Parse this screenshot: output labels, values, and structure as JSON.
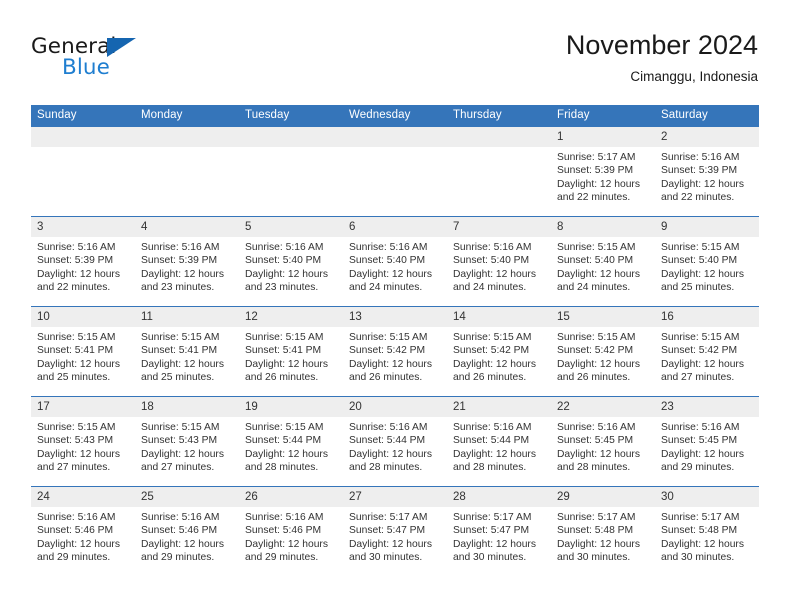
{
  "brand": {
    "word1": "General",
    "word2": "Blue",
    "logo_icon": "triangle-logo-icon",
    "accent_color": "#1f7ed0"
  },
  "header": {
    "title": "November 2024",
    "location": "Cimanggu, Indonesia"
  },
  "theme": {
    "header_bg": "#3575ba",
    "daynum_bg": "#eeeeee",
    "text": "#333333"
  },
  "calendar": {
    "weekday_headers": [
      "Sunday",
      "Monday",
      "Tuesday",
      "Wednesday",
      "Thursday",
      "Friday",
      "Saturday"
    ],
    "weeks": [
      [
        {
          "day": "",
          "empty": true
        },
        {
          "day": "",
          "empty": true
        },
        {
          "day": "",
          "empty": true
        },
        {
          "day": "",
          "empty": true
        },
        {
          "day": "",
          "empty": true
        },
        {
          "day": "1",
          "sunrise": "Sunrise: 5:17 AM",
          "sunset": "Sunset: 5:39 PM",
          "daylight1": "Daylight: 12 hours",
          "daylight2": "and 22 minutes."
        },
        {
          "day": "2",
          "sunrise": "Sunrise: 5:16 AM",
          "sunset": "Sunset: 5:39 PM",
          "daylight1": "Daylight: 12 hours",
          "daylight2": "and 22 minutes."
        }
      ],
      [
        {
          "day": "3",
          "sunrise": "Sunrise: 5:16 AM",
          "sunset": "Sunset: 5:39 PM",
          "daylight1": "Daylight: 12 hours",
          "daylight2": "and 22 minutes."
        },
        {
          "day": "4",
          "sunrise": "Sunrise: 5:16 AM",
          "sunset": "Sunset: 5:39 PM",
          "daylight1": "Daylight: 12 hours",
          "daylight2": "and 23 minutes."
        },
        {
          "day": "5",
          "sunrise": "Sunrise: 5:16 AM",
          "sunset": "Sunset: 5:40 PM",
          "daylight1": "Daylight: 12 hours",
          "daylight2": "and 23 minutes."
        },
        {
          "day": "6",
          "sunrise": "Sunrise: 5:16 AM",
          "sunset": "Sunset: 5:40 PM",
          "daylight1": "Daylight: 12 hours",
          "daylight2": "and 24 minutes."
        },
        {
          "day": "7",
          "sunrise": "Sunrise: 5:16 AM",
          "sunset": "Sunset: 5:40 PM",
          "daylight1": "Daylight: 12 hours",
          "daylight2": "and 24 minutes."
        },
        {
          "day": "8",
          "sunrise": "Sunrise: 5:15 AM",
          "sunset": "Sunset: 5:40 PM",
          "daylight1": "Daylight: 12 hours",
          "daylight2": "and 24 minutes."
        },
        {
          "day": "9",
          "sunrise": "Sunrise: 5:15 AM",
          "sunset": "Sunset: 5:40 PM",
          "daylight1": "Daylight: 12 hours",
          "daylight2": "and 25 minutes."
        }
      ],
      [
        {
          "day": "10",
          "sunrise": "Sunrise: 5:15 AM",
          "sunset": "Sunset: 5:41 PM",
          "daylight1": "Daylight: 12 hours",
          "daylight2": "and 25 minutes."
        },
        {
          "day": "11",
          "sunrise": "Sunrise: 5:15 AM",
          "sunset": "Sunset: 5:41 PM",
          "daylight1": "Daylight: 12 hours",
          "daylight2": "and 25 minutes."
        },
        {
          "day": "12",
          "sunrise": "Sunrise: 5:15 AM",
          "sunset": "Sunset: 5:41 PM",
          "daylight1": "Daylight: 12 hours",
          "daylight2": "and 26 minutes."
        },
        {
          "day": "13",
          "sunrise": "Sunrise: 5:15 AM",
          "sunset": "Sunset: 5:42 PM",
          "daylight1": "Daylight: 12 hours",
          "daylight2": "and 26 minutes."
        },
        {
          "day": "14",
          "sunrise": "Sunrise: 5:15 AM",
          "sunset": "Sunset: 5:42 PM",
          "daylight1": "Daylight: 12 hours",
          "daylight2": "and 26 minutes."
        },
        {
          "day": "15",
          "sunrise": "Sunrise: 5:15 AM",
          "sunset": "Sunset: 5:42 PM",
          "daylight1": "Daylight: 12 hours",
          "daylight2": "and 26 minutes."
        },
        {
          "day": "16",
          "sunrise": "Sunrise: 5:15 AM",
          "sunset": "Sunset: 5:42 PM",
          "daylight1": "Daylight: 12 hours",
          "daylight2": "and 27 minutes."
        }
      ],
      [
        {
          "day": "17",
          "sunrise": "Sunrise: 5:15 AM",
          "sunset": "Sunset: 5:43 PM",
          "daylight1": "Daylight: 12 hours",
          "daylight2": "and 27 minutes."
        },
        {
          "day": "18",
          "sunrise": "Sunrise: 5:15 AM",
          "sunset": "Sunset: 5:43 PM",
          "daylight1": "Daylight: 12 hours",
          "daylight2": "and 27 minutes."
        },
        {
          "day": "19",
          "sunrise": "Sunrise: 5:15 AM",
          "sunset": "Sunset: 5:44 PM",
          "daylight1": "Daylight: 12 hours",
          "daylight2": "and 28 minutes."
        },
        {
          "day": "20",
          "sunrise": "Sunrise: 5:16 AM",
          "sunset": "Sunset: 5:44 PM",
          "daylight1": "Daylight: 12 hours",
          "daylight2": "and 28 minutes."
        },
        {
          "day": "21",
          "sunrise": "Sunrise: 5:16 AM",
          "sunset": "Sunset: 5:44 PM",
          "daylight1": "Daylight: 12 hours",
          "daylight2": "and 28 minutes."
        },
        {
          "day": "22",
          "sunrise": "Sunrise: 5:16 AM",
          "sunset": "Sunset: 5:45 PM",
          "daylight1": "Daylight: 12 hours",
          "daylight2": "and 28 minutes."
        },
        {
          "day": "23",
          "sunrise": "Sunrise: 5:16 AM",
          "sunset": "Sunset: 5:45 PM",
          "daylight1": "Daylight: 12 hours",
          "daylight2": "and 29 minutes."
        }
      ],
      [
        {
          "day": "24",
          "sunrise": "Sunrise: 5:16 AM",
          "sunset": "Sunset: 5:46 PM",
          "daylight1": "Daylight: 12 hours",
          "daylight2": "and 29 minutes."
        },
        {
          "day": "25",
          "sunrise": "Sunrise: 5:16 AM",
          "sunset": "Sunset: 5:46 PM",
          "daylight1": "Daylight: 12 hours",
          "daylight2": "and 29 minutes."
        },
        {
          "day": "26",
          "sunrise": "Sunrise: 5:16 AM",
          "sunset": "Sunset: 5:46 PM",
          "daylight1": "Daylight: 12 hours",
          "daylight2": "and 29 minutes."
        },
        {
          "day": "27",
          "sunrise": "Sunrise: 5:17 AM",
          "sunset": "Sunset: 5:47 PM",
          "daylight1": "Daylight: 12 hours",
          "daylight2": "and 30 minutes."
        },
        {
          "day": "28",
          "sunrise": "Sunrise: 5:17 AM",
          "sunset": "Sunset: 5:47 PM",
          "daylight1": "Daylight: 12 hours",
          "daylight2": "and 30 minutes."
        },
        {
          "day": "29",
          "sunrise": "Sunrise: 5:17 AM",
          "sunset": "Sunset: 5:48 PM",
          "daylight1": "Daylight: 12 hours",
          "daylight2": "and 30 minutes."
        },
        {
          "day": "30",
          "sunrise": "Sunrise: 5:17 AM",
          "sunset": "Sunset: 5:48 PM",
          "daylight1": "Daylight: 12 hours",
          "daylight2": "and 30 minutes."
        }
      ]
    ]
  }
}
